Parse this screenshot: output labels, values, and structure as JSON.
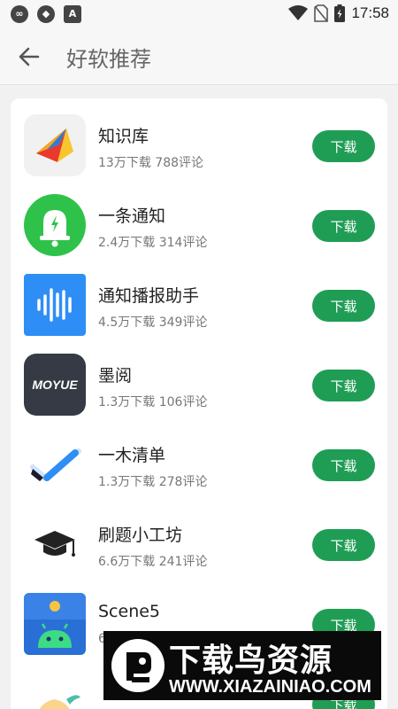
{
  "status_bar": {
    "time": "17:58"
  },
  "header": {
    "title": "好软推荐"
  },
  "apps": [
    {
      "name": "知识库",
      "downloads": "13万下载",
      "comments": "788评论",
      "button": "下载",
      "icon": "knowledge-base-icon"
    },
    {
      "name": "一条通知",
      "downloads": "2.4万下载",
      "comments": "314评论",
      "button": "下载",
      "icon": "bell-notification-icon"
    },
    {
      "name": "通知播报助手",
      "downloads": "4.5万下载",
      "comments": "349评论",
      "button": "下载",
      "icon": "sound-wave-icon"
    },
    {
      "name": "墨阅",
      "downloads": "1.3万下载",
      "comments": "106评论",
      "button": "下载",
      "icon": "moyue-logo-icon"
    },
    {
      "name": "一木清单",
      "downloads": "1.3万下载",
      "comments": "278评论",
      "button": "下载",
      "icon": "checkmark-pencil-icon"
    },
    {
      "name": "刷题小工坊",
      "downloads": "6.6万下载",
      "comments": "241评论",
      "button": "下载",
      "icon": "graduation-cap-icon"
    },
    {
      "name": "Scene5",
      "downloads": "6",
      "comments": "",
      "button": "下载",
      "icon": "android-robot-icon"
    },
    {
      "name": "",
      "downloads": "",
      "comments": "",
      "button": "下载",
      "icon": "cartoon-character-icon"
    }
  ],
  "watermark": {
    "title": "下载鸟资源",
    "url": "WWW.XIAZAINIAO.COM"
  },
  "colors": {
    "accent": "#1f9d55",
    "background": "#f1f1f1"
  }
}
